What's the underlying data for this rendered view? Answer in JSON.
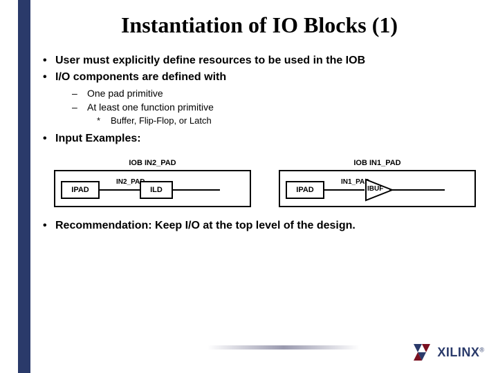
{
  "title": "Instantiation of IO Blocks (1)",
  "bullets": {
    "b1a": "User must explicitly define resources to be used in the  IOB",
    "b1b": "I/O components are defined with",
    "b2a": "One pad primitive",
    "b2b": "At least one function primitive",
    "b3a": "Buffer, Flip-Flop, or Latch",
    "b1c": "Input Examples:",
    "b1d": "Recommendation: Keep I/O at the top level of the design."
  },
  "diagrams": {
    "left": {
      "title": "IOB IN2_PAD",
      "pad": "IPAD",
      "net": "IN2_PAD",
      "prim": "ILD"
    },
    "right": {
      "title": "IOB IN1_PAD",
      "pad": "IPAD",
      "net": "IN1_PAD",
      "prim": "IBUF"
    }
  },
  "logo": "XILINX"
}
